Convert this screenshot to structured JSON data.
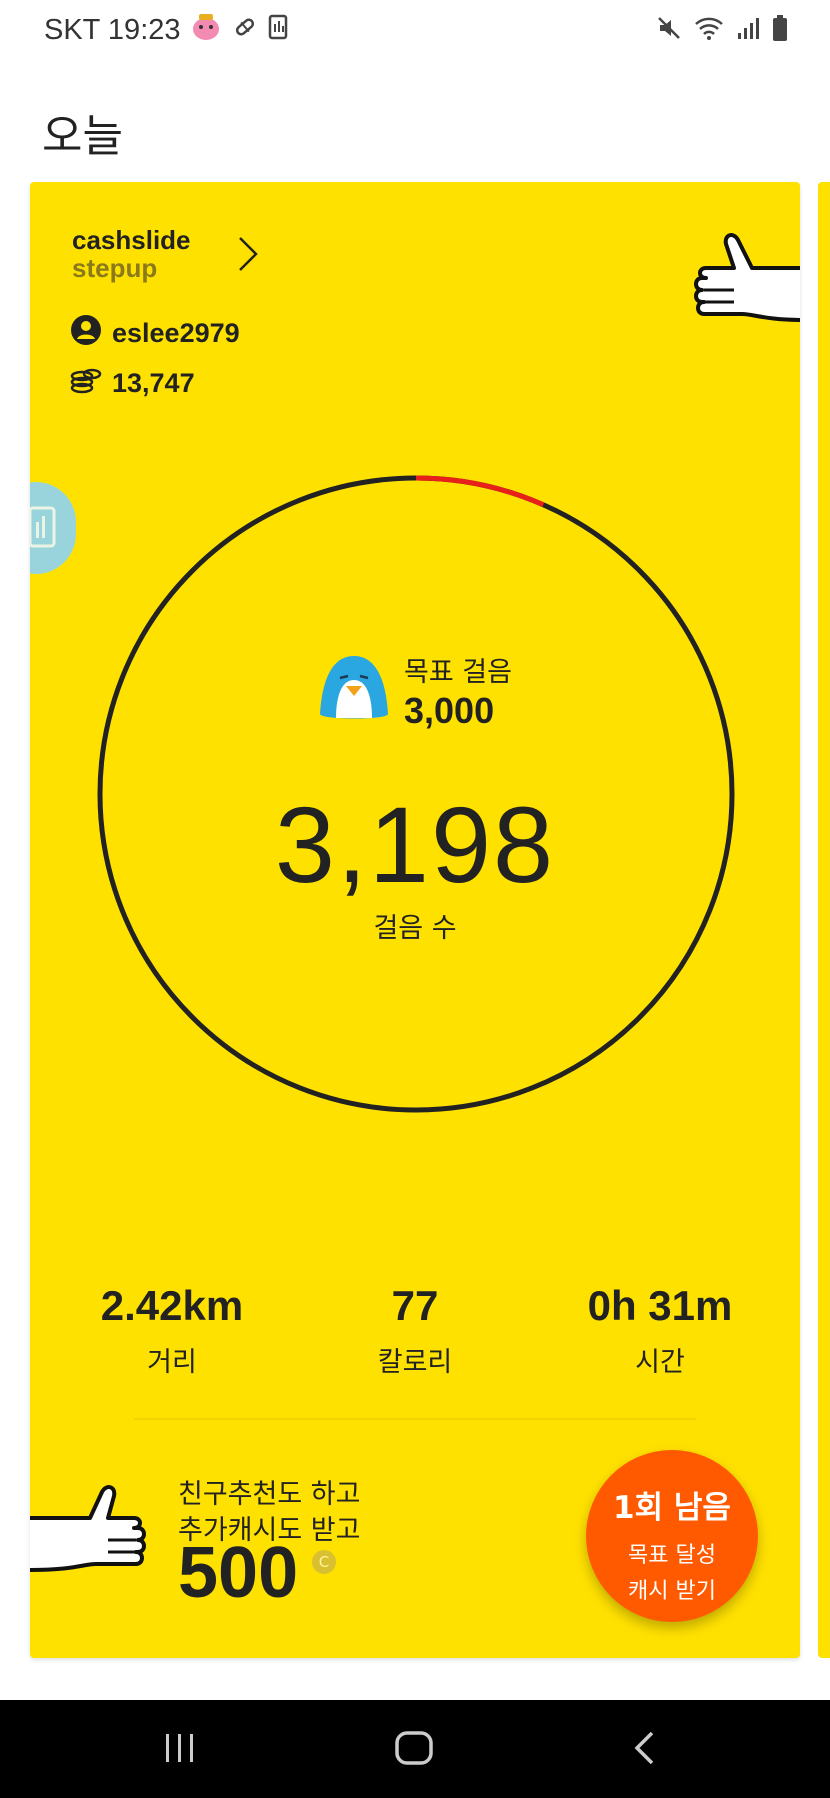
{
  "status_bar": {
    "carrier_time": "SKT 19:23",
    "left_icons": [
      "piggy-icon",
      "pill-icon",
      "device-icon"
    ],
    "right_icons": [
      "mute-icon",
      "wifi-icon",
      "signal-icon",
      "battery-icon"
    ]
  },
  "header": {
    "title": "오늘"
  },
  "card": {
    "brand_line1": "cashslide",
    "brand_line2": "stepup",
    "username": "eslee2979",
    "coins": "13,747",
    "goal_label": "목표 걸음",
    "goal_value": "3,000",
    "steps": "3,198",
    "steps_label": "걸음 수",
    "progress_fraction_overflow": 0.066,
    "stats": [
      {
        "value": "2.42km",
        "label": "거리"
      },
      {
        "value": "77",
        "label": "칼로리"
      },
      {
        "value": "0h 31m",
        "label": "시간"
      }
    ],
    "promo_line1": "친구추천도 하고",
    "promo_line2": "추가캐시도 받고",
    "promo_amount": "500",
    "promo_coin_symbol": "C",
    "badge_title": "1회 남음",
    "badge_line1": "목표 달성",
    "badge_line2": "캐시 받기"
  },
  "colors": {
    "card_bg": "#FFE100",
    "badge_bg": "#FF5A00",
    "progress_accent": "#E8201A"
  },
  "nav": {
    "icons": [
      "recent-apps-icon",
      "home-icon",
      "back-icon"
    ]
  }
}
